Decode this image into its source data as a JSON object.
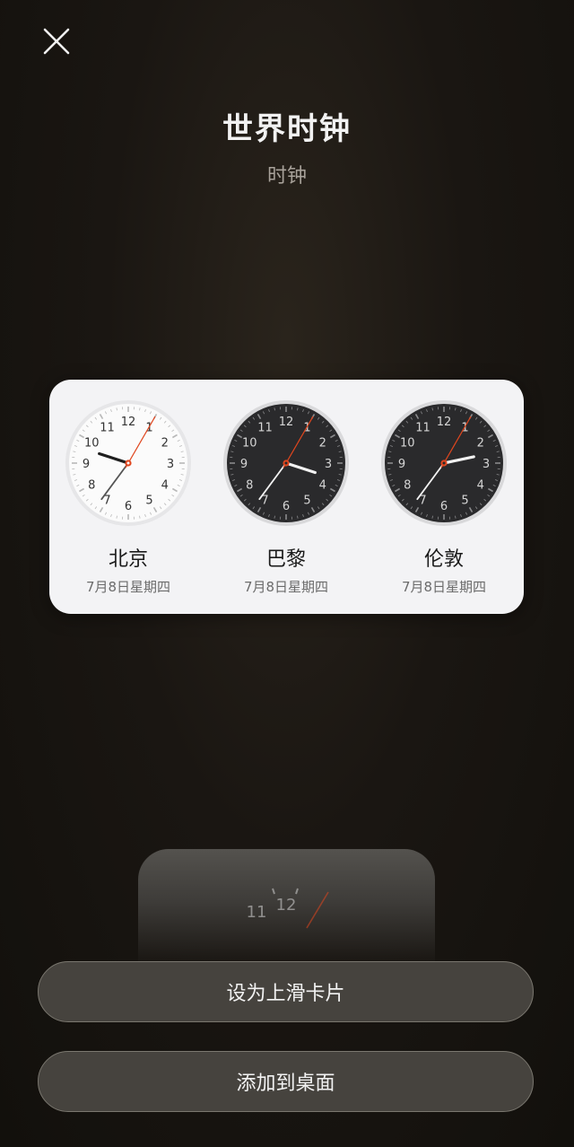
{
  "header": {
    "title": "世界时钟",
    "subtitle": "时钟"
  },
  "widget": {
    "clocks": [
      {
        "city": "北京",
        "date": "7月8日星期四",
        "theme": "light",
        "hour": 9,
        "minute": 36,
        "second": 5
      },
      {
        "city": "巴黎",
        "date": "7月8日星期四",
        "theme": "dark",
        "hour": 3,
        "minute": 36,
        "second": 5
      },
      {
        "city": "伦敦",
        "date": "7月8日星期四",
        "theme": "dark",
        "hour": 2,
        "minute": 36,
        "second": 5
      }
    ],
    "dial_numbers": [
      "12",
      "1",
      "2",
      "3",
      "4",
      "5",
      "6",
      "7",
      "8",
      "9",
      "10",
      "11"
    ]
  },
  "actions": {
    "set_swipe_card": "设为上滑卡片",
    "add_to_desktop": "添加到桌面"
  },
  "icons": {
    "close": "close-icon"
  },
  "colors": {
    "second_hand": "#e0461e",
    "widget_bg": "#f3f3f5"
  }
}
